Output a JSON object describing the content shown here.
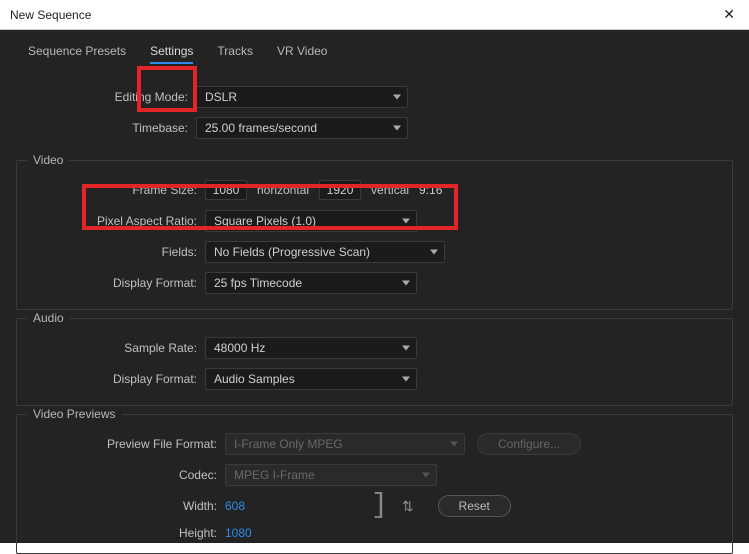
{
  "window": {
    "title": "New Sequence"
  },
  "tabs": {
    "presets": "Sequence Presets",
    "settings": "Settings",
    "tracks": "Tracks",
    "vr": "VR Video"
  },
  "top": {
    "editing_mode_label": "Editing Mode:",
    "editing_mode_value": "DSLR",
    "timebase_label": "Timebase:",
    "timebase_value": "25.00  frames/second"
  },
  "video": {
    "legend": "Video",
    "frame_size_label": "Frame Size:",
    "width": "1080",
    "horizontal": "horizontal",
    "height": "1920",
    "vertical": "vertical",
    "aspect": "9:16",
    "par_label": "Pixel Aspect Ratio:",
    "par_value": "Square Pixels (1.0)",
    "fields_label": "Fields:",
    "fields_value": "No Fields (Progressive Scan)",
    "dformat_label": "Display Format:",
    "dformat_value": "25 fps Timecode"
  },
  "audio": {
    "legend": "Audio",
    "rate_label": "Sample Rate:",
    "rate_value": "48000 Hz",
    "dformat_label": "Display Format:",
    "dformat_value": "Audio Samples"
  },
  "previews": {
    "legend": "Video Previews",
    "pff_label": "Preview File Format:",
    "pff_value": "I-Frame Only MPEG",
    "configure": "Configure...",
    "codec_label": "Codec:",
    "codec_value": "MPEG I-Frame",
    "width_label": "Width:",
    "width_value": "608",
    "height_label": "Height:",
    "height_value": "1080",
    "reset": "Reset"
  }
}
